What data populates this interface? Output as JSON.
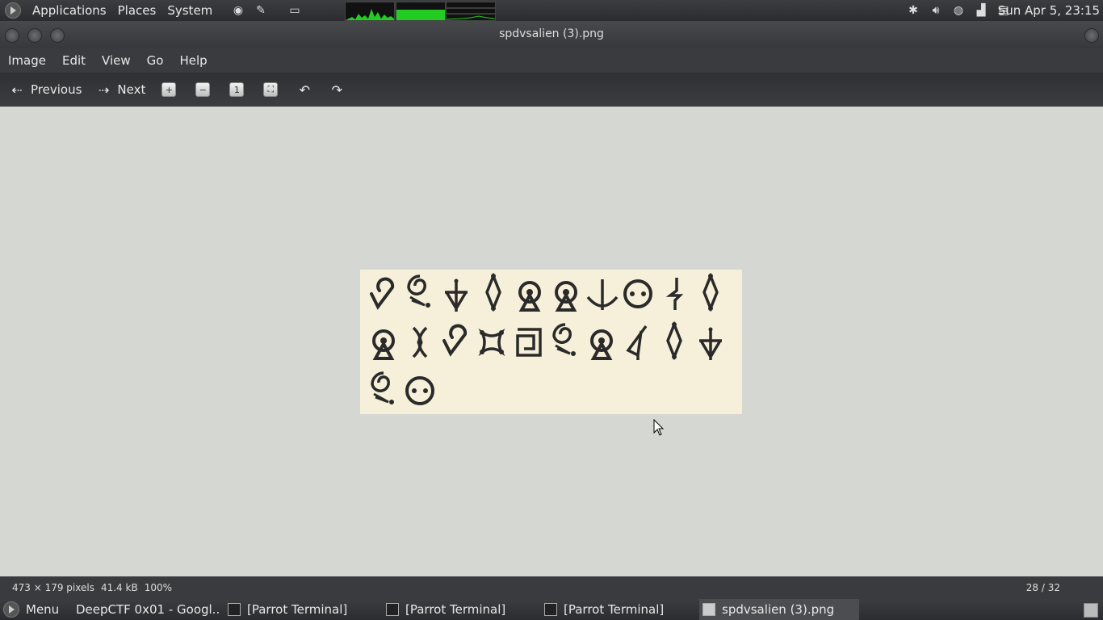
{
  "top_panel": {
    "menus": [
      "Applications",
      "Places",
      "System"
    ],
    "clock": "Sun Apr  5, 23:15"
  },
  "window": {
    "title": "spdvsalien (3).png"
  },
  "menubar": [
    "Image",
    "Edit",
    "View",
    "Go",
    "Help"
  ],
  "toolbar": {
    "previous_label": "Previous",
    "next_label": "Next"
  },
  "status": {
    "dimensions": "473 × 179 pixels",
    "size": "41.4 kB",
    "zoom": "100%",
    "position": "28 / 32"
  },
  "taskbar": {
    "menu_label": "Menu",
    "tasks": [
      "DeepCTF 0x01 - Googl...",
      "[Parrot Terminal]",
      "[Parrot Terminal]",
      "[Parrot Terminal]",
      "spdvsalien (3).png"
    ]
  },
  "colors": {
    "viewer_bg": "#d5d8d2",
    "image_bg": "#f6f0da",
    "glyph_ink": "#2a2a2a",
    "monitor_green": "#22cc22"
  }
}
